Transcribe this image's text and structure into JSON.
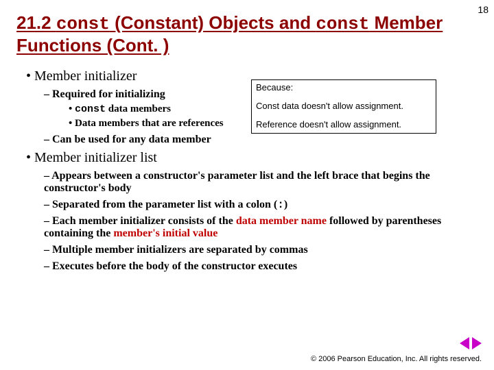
{
  "page_number": "18",
  "title": {
    "prefix": "21.2 ",
    "kw1": "const",
    "mid": " (Constant) Objects and ",
    "kw2": "const",
    "suffix": " Member Functions (Cont. )"
  },
  "callout_because": {
    "header": "Because:",
    "line1": "Const data doesn't allow assignment.",
    "line2": "Reference doesn't allow assignment."
  },
  "bullets": {
    "b1": "Member initializer",
    "b1_1": "Required for initializing",
    "b1_1_1_kw": "const",
    "b1_1_1_rest": " data members",
    "b1_1_2": "Data members that are references",
    "b1_2": "Can be used for any data member",
    "b2": "Member initializer list",
    "b2_1a": "Appears between a constructor's parameter list and the left brace that begins the constructor's body",
    "b2_2_pre": "Separated from the parameter list with a colon (",
    "b2_2_colon": ":",
    "b2_2_post": ")",
    "b2_3_pre": "Each member initializer consists of the ",
    "b2_3_red1": "data member name",
    "b2_3_mid": " followed by parentheses containing the ",
    "b2_3_red2": "member's initial value",
    "b2_4": "Multiple member initializers are separated by commas",
    "b2_5": "Executes before the body of the constructor executes"
  },
  "footer": {
    "copyright": "2006 Pearson Education, Inc.  All rights reserved."
  }
}
